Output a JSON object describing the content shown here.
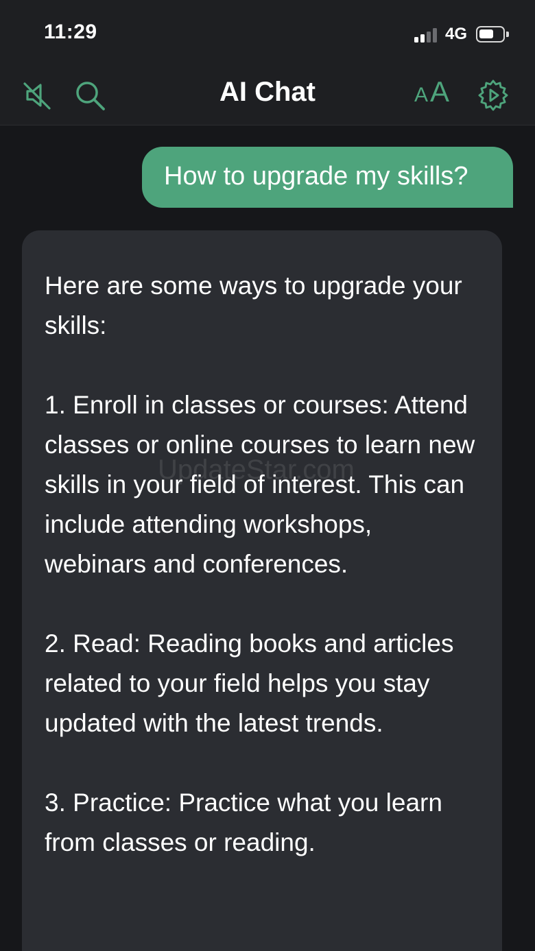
{
  "status_bar": {
    "time": "11:29",
    "network": "4G"
  },
  "header": {
    "title": "AI Chat",
    "font_size_small": "A",
    "font_size_big": "A",
    "icons": [
      "mute-icon",
      "search-icon",
      "font-size-icon",
      "settings-icon"
    ]
  },
  "colors": {
    "accent": "#4ea47c",
    "background": "#16171a",
    "bar": "#1e1f22",
    "ai_bubble": "#2b2d32"
  },
  "messages": {
    "user": "How to upgrade my skills?",
    "ai": {
      "intro": "Here are some ways to upgrade your skills:",
      "item1": "1. Enroll in classes or courses: Attend classes or online courses to learn new skills in your field of interest. This can include attending workshops, webinars and conferences.",
      "item2": "2. Read: Reading books and articles related to your field helps you stay updated with the latest trends.",
      "item3": "3. Practice: Practice what you learn from classes or reading."
    }
  },
  "watermark": "UpdateStar.com"
}
